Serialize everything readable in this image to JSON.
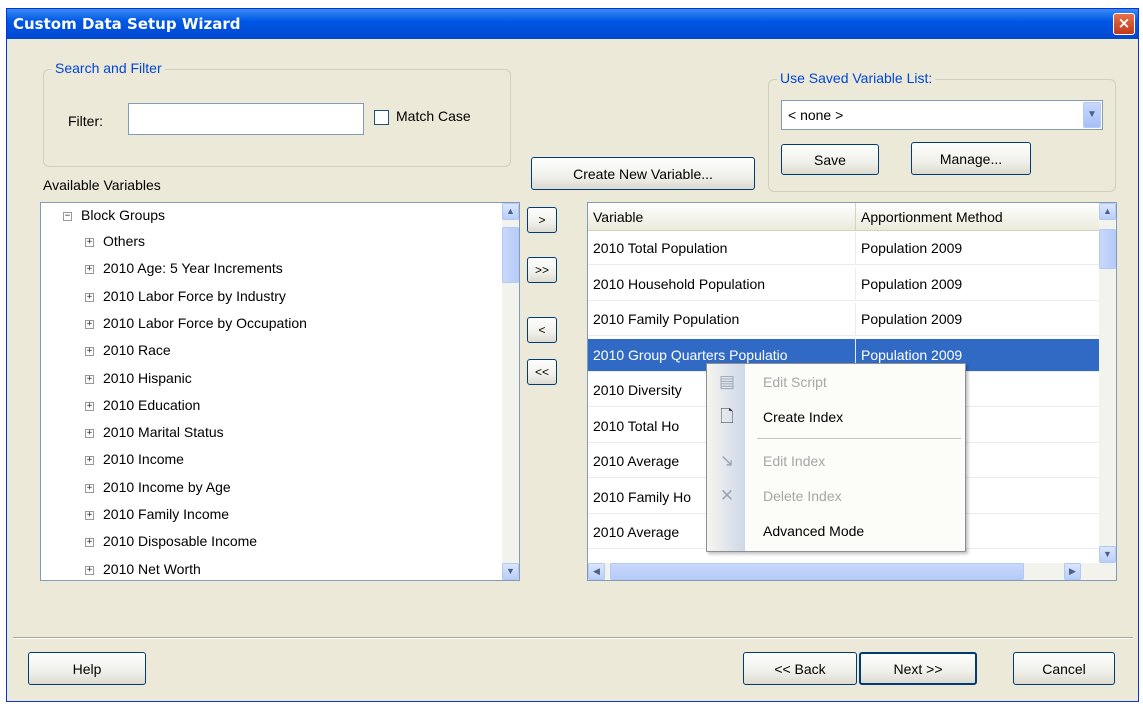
{
  "window": {
    "title": "Custom Data Setup Wizard",
    "close_label": "×"
  },
  "search": {
    "group_title": "Search and Filter",
    "filter_label": "Filter:",
    "filter_value": "",
    "match_case_label": "Match Case"
  },
  "saved_list": {
    "group_title": "Use Saved Variable List:",
    "selected": "< none >",
    "save_label": "Save",
    "manage_label": "Manage..."
  },
  "create_variable_label": "Create New Variable...",
  "available": {
    "title": "Available Variables",
    "root": "Block Groups",
    "items": [
      "Others",
      "2010 Age: 5 Year Increments",
      "2010 Labor Force by Industry",
      "2010 Labor Force by Occupation",
      "2010 Race",
      "2010 Hispanic",
      "2010 Education",
      "2010 Marital Status",
      "2010 Income",
      "2010 Income by Age",
      "2010 Family Income",
      "2010 Disposable Income",
      "2010 Net Worth"
    ]
  },
  "transfer": {
    "add_one": ">",
    "add_all": ">>",
    "remove_one": "<",
    "remove_all": "<<"
  },
  "selected_grid": {
    "columns": [
      "Variable",
      "Apportionment Method"
    ],
    "rows": [
      [
        "2010 Total Population",
        "Population 2009"
      ],
      [
        "2010 Household Population",
        "Population 2009"
      ],
      [
        "2010 Family Population",
        "Population 2009"
      ],
      [
        "2010 Group Quarters Populatio",
        "Population 2009"
      ],
      [
        "2010 Diversity",
        ""
      ],
      [
        "2010 Total Ho",
        "009"
      ],
      [
        "2010 Average",
        ""
      ],
      [
        "2010 Family Ho",
        "009"
      ],
      [
        "2010 Average",
        ""
      ]
    ],
    "selected_row": 3
  },
  "context_menu": {
    "items": [
      {
        "label": "Edit Script",
        "enabled": false,
        "icon": "script-icon"
      },
      {
        "label": "Create Index",
        "enabled": true,
        "icon": "new-document-icon"
      },
      {
        "label": "Edit Index",
        "enabled": false,
        "icon": "edit-arrow-icon"
      },
      {
        "label": "Delete Index",
        "enabled": false,
        "icon": "delete-x-icon"
      },
      {
        "label": "Advanced Mode",
        "enabled": true,
        "icon": ""
      }
    ]
  },
  "footer": {
    "help_label": "Help",
    "back_label": "<< Back",
    "next_label": "Next >>",
    "cancel_label": "Cancel"
  }
}
